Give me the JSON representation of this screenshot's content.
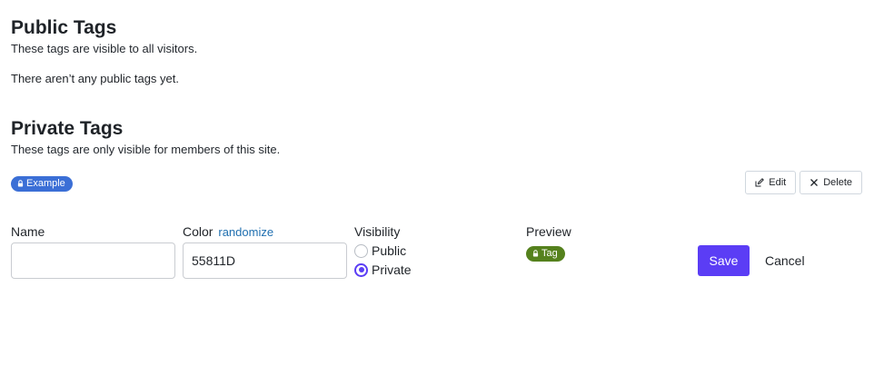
{
  "public_section": {
    "title": "Public Tags",
    "subtitle": "These tags are visible to all visitors.",
    "empty_message": "There aren’t any public tags yet."
  },
  "private_section": {
    "title": "Private Tags",
    "subtitle": "These tags are only visible for members of this site.",
    "tags": [
      {
        "label": "Example",
        "color": "#3b6fd6",
        "icon": "lock-icon"
      }
    ],
    "actions": {
      "edit_label": "Edit",
      "delete_label": "Delete"
    }
  },
  "form": {
    "name_label": "Name",
    "name_value": "",
    "color_label": "Color",
    "randomize_label": "randomize",
    "color_value": "55811D",
    "visibility_label": "Visibility",
    "visibility_options": [
      {
        "label": "Public",
        "checked": false
      },
      {
        "label": "Private",
        "checked": true
      }
    ],
    "preview_label": "Preview",
    "preview_tag": {
      "label": "Tag",
      "color": "#55811D",
      "icon": "lock-icon"
    },
    "save_label": "Save",
    "cancel_label": "Cancel"
  },
  "colors": {
    "accent": "#5b3df5",
    "link": "#1f6fb0"
  }
}
